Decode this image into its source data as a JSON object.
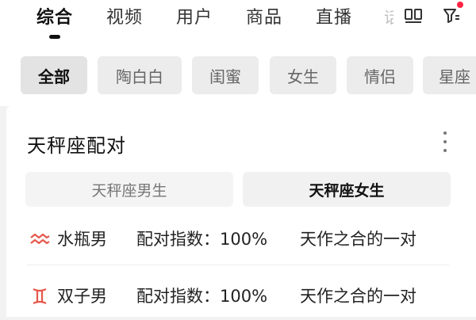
{
  "colors": {
    "accent_red": "#ff2442",
    "zodiac_symbol": "#e6574a"
  },
  "top_tabs": [
    {
      "label": "综合",
      "active": true
    },
    {
      "label": "视频",
      "active": false
    },
    {
      "label": "用户",
      "active": false
    },
    {
      "label": "商品",
      "active": false
    },
    {
      "label": "直播",
      "active": false
    }
  ],
  "top_tab_overflow": "话",
  "top_icons": [
    "grid-view-icon",
    "filter-icon"
  ],
  "chips": [
    {
      "label": "全部",
      "active": true
    },
    {
      "label": "陶白白",
      "active": false
    },
    {
      "label": "闺蜜",
      "active": false
    },
    {
      "label": "女生",
      "active": false
    },
    {
      "label": "情侣",
      "active": false
    },
    {
      "label": "星座",
      "active": false
    }
  ],
  "card": {
    "title": "天秤座配对",
    "segments": [
      {
        "label": "天秤座男生",
        "active": false
      },
      {
        "label": "天秤座女生",
        "active": true
      }
    ],
    "rows": [
      {
        "icon": "aquarius-icon",
        "name": "水瓶男",
        "score": "配对指数：100%",
        "desc": "天作之合的一对"
      },
      {
        "icon": "gemini-icon",
        "name": "双子男",
        "score": "配对指数：100%",
        "desc": "天作之合的一对"
      }
    ]
  }
}
